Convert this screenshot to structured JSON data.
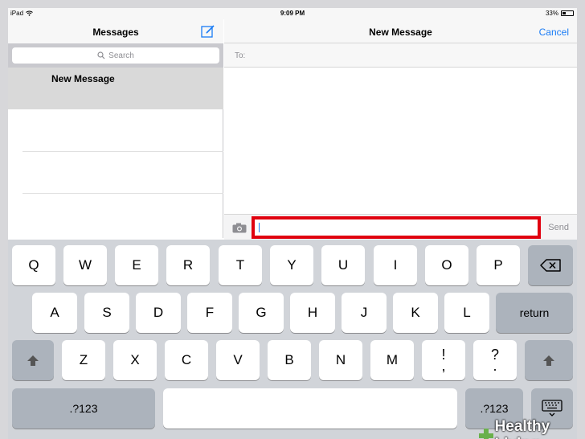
{
  "status_bar": {
    "device": "iPad",
    "time": "9:09 PM",
    "battery": "33%"
  },
  "left_pane": {
    "title": "Messages",
    "search_placeholder": "Search",
    "conversations": [
      {
        "name": "New Message"
      }
    ]
  },
  "right_pane": {
    "title": "New Message",
    "cancel_label": "Cancel",
    "to_label": "To:"
  },
  "composer": {
    "value": "",
    "send_label": "Send",
    "highlight_color": "#e0000f"
  },
  "keyboard": {
    "row1": [
      "Q",
      "W",
      "E",
      "R",
      "T",
      "Y",
      "U",
      "I",
      "O",
      "P"
    ],
    "row2": [
      "A",
      "S",
      "D",
      "F",
      "G",
      "H",
      "J",
      "K",
      "L"
    ],
    "return_label": "return",
    "row3": [
      "Z",
      "X",
      "C",
      "V",
      "B",
      "N",
      "M"
    ],
    "punct1": {
      "top": "!",
      "bottom": ","
    },
    "punct2": {
      "top": "?",
      "bottom": "."
    },
    "numbers_label": ".?123"
  },
  "watermark": {
    "text": "Healthy Living"
  },
  "colors": {
    "accent": "#1a7cf5",
    "keyboard_bg": "#d1d4d9"
  }
}
